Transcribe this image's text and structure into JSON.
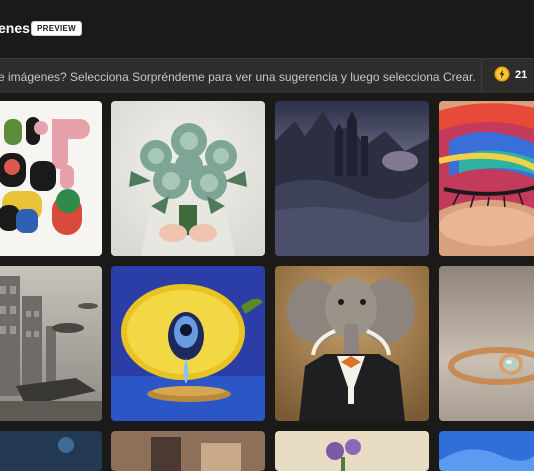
{
  "header": {
    "title": "enes",
    "badge": "PREVIEW"
  },
  "prompt": {
    "text": "e imágenes? Selecciona Sorpréndeme para ver una sugerencia y luego selecciona Crear."
  },
  "boosts": {
    "count": "21",
    "icon": "boost-coin-icon"
  },
  "gallery": {
    "items": [
      {
        "name": "abstract-shapes-image"
      },
      {
        "name": "succulent-bouquet-image"
      },
      {
        "name": "dark-castle-landscape-image"
      },
      {
        "name": "colorful-eye-makeup-image"
      },
      {
        "name": "futuristic-city-image"
      },
      {
        "name": "lemon-eye-image"
      },
      {
        "name": "elephant-tuxedo-image"
      },
      {
        "name": "gold-ring-image"
      },
      {
        "name": "bottom-row-image-1"
      },
      {
        "name": "bottom-row-image-2"
      },
      {
        "name": "bottom-row-image-3"
      },
      {
        "name": "bottom-row-image-4"
      }
    ]
  }
}
